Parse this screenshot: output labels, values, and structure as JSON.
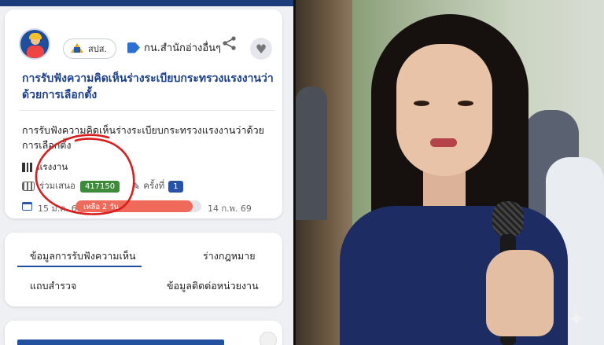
{
  "left_panel": {
    "header": {
      "agency_label": "สปส.",
      "category_label": "กน.สำนักอ่างอื่นๆ"
    },
    "card": {
      "title": "การรับฟังความคิดเห็นร่างระเบียบกระทรวงแรงงานว่าด้วยการเลือกตั้ง",
      "description": "การรับฟังความคิดเห็นร่างระเบียบกระทรวงแรงงานว่าด้วยการเลือกตั้ง",
      "ministry": "แรงงาน",
      "participants_label": "ร่วมเสนอ",
      "participants_count": "417150",
      "round_label": "ครั้งที่",
      "round_number": "1",
      "date_start": "15 ม.ค. 69",
      "date_end": "14 ก.พ. 69",
      "remaining_text": "เหลือ 2 วัน",
      "progress_fraction": 0.93,
      "annotation_color": "#d81f1f"
    },
    "tabs": {
      "tab1": "ข้อมูลการรับฟังความเห็น",
      "tab2": "ร่างกฎหมาย",
      "tab3": "แถบสำรวจ",
      "tab4": "ข้อมูลติดต่อหน่วยงาน"
    }
  },
  "right_panel": {
    "description_icon": "person-photo"
  }
}
